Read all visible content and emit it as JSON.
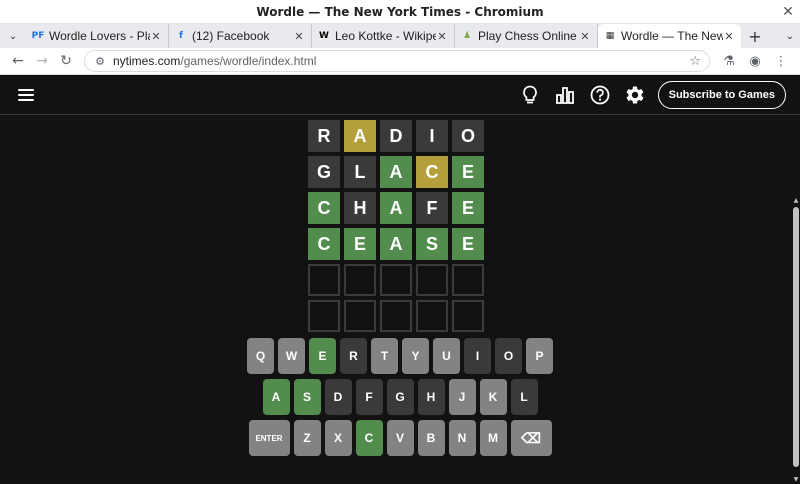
{
  "window": {
    "title": "Wordle — The New York Times - Chromium"
  },
  "tabs": [
    {
      "label": "Wordle Lovers - Play",
      "favicon": "PF",
      "favicon_color": "#1a73e8"
    },
    {
      "label": "(12) Facebook",
      "favicon": "f",
      "favicon_color": "#1877f2"
    },
    {
      "label": "Leo Kottke - Wikipedi",
      "favicon": "W",
      "favicon_color": "#000000"
    },
    {
      "label": "Play Chess Online for",
      "favicon": "♟",
      "favicon_color": "#7fa650"
    },
    {
      "label": "Wordle — The New Y",
      "favicon": "▦",
      "favicon_color": "#333333",
      "active": true
    }
  ],
  "address": {
    "domain": "nytimes.com",
    "path": "/games/wordle/index.html"
  },
  "header": {
    "subscribe_label": "Subscribe to Games"
  },
  "colors": {
    "correct": "#538d4e",
    "present": "#b59f3b",
    "absent": "#3a3a3c",
    "unused": "#818384",
    "background": "#121213"
  },
  "board": [
    [
      {
        "l": "R",
        "s": "absent"
      },
      {
        "l": "A",
        "s": "present"
      },
      {
        "l": "D",
        "s": "absent"
      },
      {
        "l": "I",
        "s": "absent"
      },
      {
        "l": "O",
        "s": "absent"
      }
    ],
    [
      {
        "l": "G",
        "s": "absent"
      },
      {
        "l": "L",
        "s": "absent"
      },
      {
        "l": "A",
        "s": "correct"
      },
      {
        "l": "C",
        "s": "present"
      },
      {
        "l": "E",
        "s": "correct"
      }
    ],
    [
      {
        "l": "C",
        "s": "correct"
      },
      {
        "l": "H",
        "s": "absent"
      },
      {
        "l": "A",
        "s": "correct"
      },
      {
        "l": "F",
        "s": "absent"
      },
      {
        "l": "E",
        "s": "correct"
      }
    ],
    [
      {
        "l": "C",
        "s": "correct"
      },
      {
        "l": "E",
        "s": "correct"
      },
      {
        "l": "A",
        "s": "correct"
      },
      {
        "l": "S",
        "s": "correct"
      },
      {
        "l": "E",
        "s": "correct"
      }
    ],
    [
      {
        "l": "",
        "s": "empty"
      },
      {
        "l": "",
        "s": "empty"
      },
      {
        "l": "",
        "s": "empty"
      },
      {
        "l": "",
        "s": "empty"
      },
      {
        "l": "",
        "s": "empty"
      }
    ],
    [
      {
        "l": "",
        "s": "empty"
      },
      {
        "l": "",
        "s": "empty"
      },
      {
        "l": "",
        "s": "empty"
      },
      {
        "l": "",
        "s": "empty"
      },
      {
        "l": "",
        "s": "empty"
      }
    ]
  ],
  "keyboard": [
    [
      {
        "k": "Q",
        "s": "unused"
      },
      {
        "k": "W",
        "s": "unused"
      },
      {
        "k": "E",
        "s": "correct"
      },
      {
        "k": "R",
        "s": "absent"
      },
      {
        "k": "T",
        "s": "unused"
      },
      {
        "k": "Y",
        "s": "unused"
      },
      {
        "k": "U",
        "s": "unused"
      },
      {
        "k": "I",
        "s": "absent"
      },
      {
        "k": "O",
        "s": "absent"
      },
      {
        "k": "P",
        "s": "unused"
      }
    ],
    [
      {
        "k": "A",
        "s": "correct"
      },
      {
        "k": "S",
        "s": "correct"
      },
      {
        "k": "D",
        "s": "absent"
      },
      {
        "k": "F",
        "s": "absent"
      },
      {
        "k": "G",
        "s": "absent"
      },
      {
        "k": "H",
        "s": "absent"
      },
      {
        "k": "J",
        "s": "unused"
      },
      {
        "k": "K",
        "s": "unused"
      },
      {
        "k": "L",
        "s": "absent"
      }
    ],
    [
      {
        "k": "ENTER",
        "s": "unused",
        "wide": true,
        "name": "enter-key"
      },
      {
        "k": "Z",
        "s": "unused"
      },
      {
        "k": "X",
        "s": "unused"
      },
      {
        "k": "C",
        "s": "correct"
      },
      {
        "k": "V",
        "s": "unused"
      },
      {
        "k": "B",
        "s": "unused"
      },
      {
        "k": "N",
        "s": "unused"
      },
      {
        "k": "M",
        "s": "unused"
      },
      {
        "k": "⌫",
        "s": "unused",
        "wide": true,
        "name": "backspace-key"
      }
    ]
  ]
}
